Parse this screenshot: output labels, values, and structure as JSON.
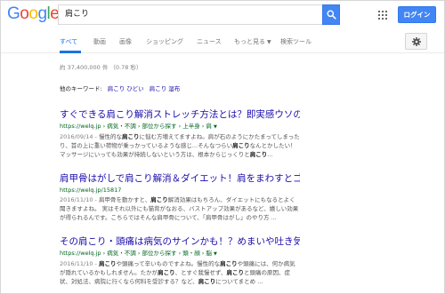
{
  "header": {
    "logo_letters": [
      {
        "ch": "G",
        "color": "#4285f4"
      },
      {
        "ch": "o",
        "color": "#ea4335"
      },
      {
        "ch": "o",
        "color": "#fbbc05"
      },
      {
        "ch": "g",
        "color": "#4285f4"
      },
      {
        "ch": "l",
        "color": "#34a853"
      },
      {
        "ch": "e",
        "color": "#ea4335"
      }
    ],
    "search_query": "肩こり",
    "login_label": "ログイン"
  },
  "tabs": {
    "all": "すべて",
    "videos": "動画",
    "images": "画像",
    "shopping": "ショッピング",
    "news": "ニュース",
    "more": "もっと見る",
    "search_tools": "検索ツール"
  },
  "stats": "約 37,400,000 件 （0.78 秒）",
  "keywords": {
    "label": "他のキーワード:",
    "items": [
      "肩こり ひどい",
      "肩こり 湿布"
    ]
  },
  "results": [
    {
      "title": "すぐできる肩こり解消ストレッチ方法とは？即実感ウソのよ...",
      "url": "https://welq.jp › 病気・不調 › 部位から探す › 上半身 › 肩",
      "date": "2016/09/14 - ",
      "snippet_parts": [
        {
          "t": "慢性的な"
        },
        {
          "t": "肩こり",
          "b": true
        },
        {
          "t": "に悩む方増えてますよね。肩が石のようにかたまってしまったり、首の上に重い荷物が乗っかっているような感じ...そんなつらい"
        },
        {
          "t": "肩こり",
          "b": true
        },
        {
          "t": "なんとかしたい！ マッサージにいっても効果が持続しないという方は、根本からじっくりと"
        },
        {
          "t": "肩こり",
          "b": true
        },
        {
          "t": "..."
        }
      ]
    },
    {
      "title": "肩甲骨はがしで肩こり解消＆ダイエット！肩をまわすとゴリ...",
      "url": "https://welq.jp/15817",
      "date": "2016/11/10 - ",
      "snippet_parts": [
        {
          "t": "肩甲骨を動かすと、"
        },
        {
          "t": "肩こり",
          "b": true
        },
        {
          "t": "解消効果はもちろん、ダイエットにもなるとよく聞きますよね。 実はそれ以外にも猫背がなおる、バストアップ効果があるなど、嬉しい効果が得られるんです。こちらではそんな肩甲骨について、「肩甲骨はがし」のやり方 ..."
        }
      ]
    },
    {
      "title": "その肩こり・頭痛は病気のサインかも！？めまいや吐き気に...",
      "url": "https://welq.jp › 病気・不調 › 部位から探す › 頭・顔 › 脳",
      "date": "2016/11/10 - ",
      "snippet_parts": [
        {
          "t": "肩こり",
          "b": true
        },
        {
          "t": "や頭痛って辛いものですよね。慢性的な"
        },
        {
          "t": "肩こり",
          "b": true
        },
        {
          "t": "や頭痛には、何か病気が隠れているかもしれません。たかが"
        },
        {
          "t": "肩こり",
          "b": true
        },
        {
          "t": "、とすぐ我慢せず、"
        },
        {
          "t": "肩こり",
          "b": true
        },
        {
          "t": "と頭痛の原因、症状、対処法、病院に行くなら何科を受診する？など、"
        },
        {
          "t": "肩こり",
          "b": true
        },
        {
          "t": "についてまとめ ..."
        }
      ]
    }
  ],
  "colors": {
    "accent": "#4285f4",
    "link": "#1a0dab",
    "url_green": "#006621",
    "snippet": "#545454"
  },
  "icons": [
    "search-icon",
    "apps-grid-icon",
    "gear-icon",
    "chevron-down-icon"
  ]
}
